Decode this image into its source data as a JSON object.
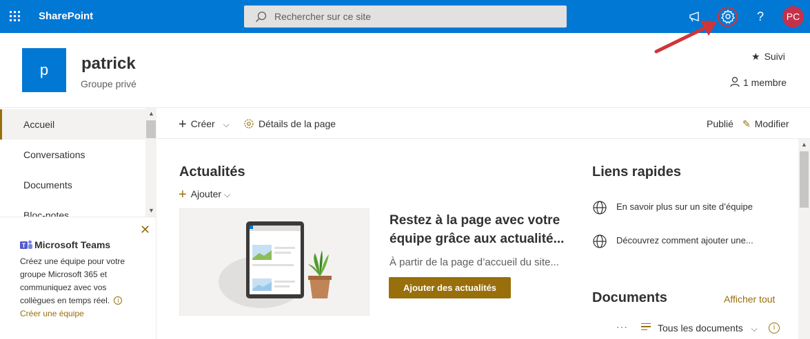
{
  "suitebar": {
    "brand": "SharePoint",
    "search_placeholder": "Rechercher sur ce site",
    "avatar_initials": "PC",
    "help_label": "?"
  },
  "site": {
    "logo_letter": "p",
    "title": "patrick",
    "subtitle": "Groupe privé",
    "follow_label": "Suivi",
    "members_label": "1 membre"
  },
  "nav": {
    "items": [
      {
        "label": "Accueil"
      },
      {
        "label": "Conversations"
      },
      {
        "label": "Documents"
      },
      {
        "label": "Bloc-notes"
      }
    ]
  },
  "teams_card": {
    "title": "Microsoft Teams",
    "description": "Créez une équipe pour votre groupe Microsoft 365 et communiquez avec vos collègues en temps réel.",
    "link": "Créer une équipe"
  },
  "command_bar": {
    "create": "Créer",
    "page_details": "Détails de la page",
    "published": "Publié",
    "edit": "Modifier"
  },
  "news": {
    "title": "Actualités",
    "add": "Ajouter",
    "headline": "Restez à la page avec votre équipe grâce aux actualité...",
    "subtext": "À partir de la page d’accueil du site...",
    "button": "Ajouter des actualités"
  },
  "quick_links": {
    "title": "Liens rapides",
    "items": [
      {
        "label": "En savoir plus sur un site d’équipe"
      },
      {
        "label": "Découvrez comment ajouter une..."
      }
    ]
  },
  "documents": {
    "title": "Documents",
    "view_all": "Afficher tout",
    "more": "···",
    "view_label": "Tous les documents"
  },
  "colors": {
    "suitebar": "#0078d4",
    "accent": "#986f0b",
    "avatar": "#c4314b",
    "annotation": "#d13438"
  }
}
